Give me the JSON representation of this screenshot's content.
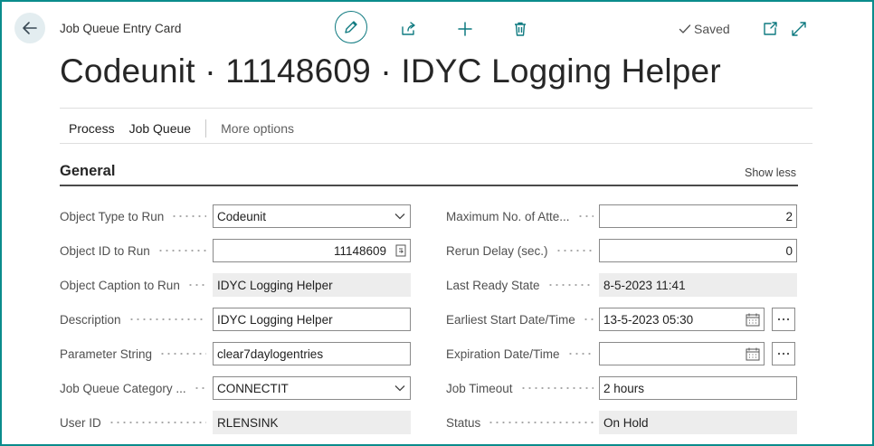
{
  "header": {
    "caption": "Job Queue Entry Card",
    "title": "Codeunit · 11148609 · IDYC Logging Helper",
    "saved_label": "Saved"
  },
  "actions": {
    "process": "Process",
    "job_queue": "Job Queue",
    "more_options": "More options"
  },
  "section": {
    "title": "General",
    "show_less": "Show less"
  },
  "left_fields": {
    "object_type": {
      "label": "Object Type to Run",
      "value": "Codeunit"
    },
    "object_id": {
      "label": "Object ID to Run",
      "value": "11148609"
    },
    "object_caption": {
      "label": "Object Caption to Run",
      "value": "IDYC Logging Helper"
    },
    "description": {
      "label": "Description",
      "value": "IDYC Logging Helper"
    },
    "parameter_string": {
      "label": "Parameter String",
      "value": "clear7daylogentries"
    },
    "category": {
      "label": "Job Queue Category ...",
      "value": "CONNECTIT"
    },
    "user_id": {
      "label": "User ID",
      "value": "RLENSINK"
    }
  },
  "right_fields": {
    "max_attempts": {
      "label": "Maximum No. of Atte...",
      "value": "2"
    },
    "rerun_delay": {
      "label": "Rerun Delay (sec.)",
      "value": "0"
    },
    "last_ready_state": {
      "label": "Last Ready State",
      "value": "8-5-2023 11:41"
    },
    "earliest_start": {
      "label": "Earliest Start Date/Time",
      "value": "13-5-2023 05:30"
    },
    "expiration": {
      "label": "Expiration Date/Time",
      "value": ""
    },
    "job_timeout": {
      "label": "Job Timeout",
      "value": "2 hours"
    },
    "status": {
      "label": "Status",
      "value": "On Hold"
    }
  }
}
